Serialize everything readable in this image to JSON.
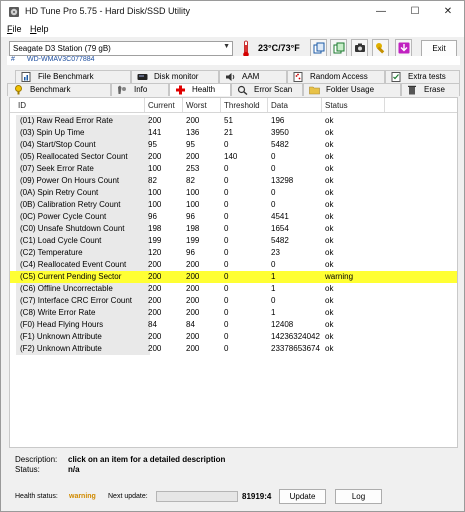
{
  "window": {
    "title": "HD Tune Pro 5.75 - Hard Disk/SSD Utility",
    "controls": [
      "—",
      "☐",
      "✕"
    ]
  },
  "menu": [
    {
      "label": "File",
      "key": "F",
      "rest": "ile"
    },
    {
      "label": "Help",
      "key": "H",
      "rest": "elp"
    }
  ],
  "toolbar": {
    "drive": "Seagate D3 Station (79 gB)",
    "temperature": "23°C/73°F",
    "exit_label": "Exit"
  },
  "serial": {
    "hash": "#",
    "id": "WD-WMAV3C077884"
  },
  "tabs_top": [
    {
      "label": "File Benchmark",
      "icon": "file-benchmark-icon"
    },
    {
      "label": "Disk monitor",
      "icon": "disk-monitor-icon"
    },
    {
      "label": "AAM",
      "icon": "speaker-icon"
    },
    {
      "label": "Random Access",
      "icon": "random-access-icon"
    },
    {
      "label": "Extra tests",
      "icon": "extra-tests-icon"
    }
  ],
  "tabs_bottom": [
    {
      "label": "Benchmark",
      "icon": "benchmark-icon"
    },
    {
      "label": "Info",
      "icon": "info-icon"
    },
    {
      "label": "Health",
      "icon": "health-cross-icon",
      "active": true
    },
    {
      "label": "Error Scan",
      "icon": "error-scan-icon"
    },
    {
      "label": "Folder Usage",
      "icon": "folder-icon"
    },
    {
      "label": "Erase",
      "icon": "erase-icon"
    }
  ],
  "table": {
    "headers": [
      "ID",
      "Current",
      "Worst",
      "Threshold",
      "Data",
      "Status"
    ],
    "rows": [
      [
        "(01) Raw Read Error Rate",
        "200",
        "200",
        "51",
        "196",
        "ok"
      ],
      [
        "(03) Spin Up Time",
        "141",
        "136",
        "21",
        "3950",
        "ok"
      ],
      [
        "(04) Start/Stop Count",
        "95",
        "95",
        "0",
        "5482",
        "ok"
      ],
      [
        "(05) Reallocated Sector Count",
        "200",
        "200",
        "140",
        "0",
        "ok"
      ],
      [
        "(07) Seek Error Rate",
        "100",
        "253",
        "0",
        "0",
        "ok"
      ],
      [
        "(09) Power On Hours Count",
        "82",
        "82",
        "0",
        "13298",
        "ok"
      ],
      [
        "(0A) Spin Retry Count",
        "100",
        "100",
        "0",
        "0",
        "ok"
      ],
      [
        "(0B) Calibration Retry Count",
        "100",
        "100",
        "0",
        "0",
        "ok"
      ],
      [
        "(0C) Power Cycle Count",
        "96",
        "96",
        "0",
        "4541",
        "ok"
      ],
      [
        "(C0) Unsafe Shutdown Count",
        "198",
        "198",
        "0",
        "1654",
        "ok"
      ],
      [
        "(C1) Load Cycle Count",
        "199",
        "199",
        "0",
        "5482",
        "ok"
      ],
      [
        "(C2) Temperature",
        "120",
        "96",
        "0",
        "23",
        "ok"
      ],
      [
        "(C4) Reallocated Event Count",
        "200",
        "200",
        "0",
        "0",
        "ok"
      ],
      [
        "(C5) Current Pending Sector",
        "200",
        "200",
        "0",
        "1",
        "warning"
      ],
      [
        "(C6) Offline Uncorrectable",
        "200",
        "200",
        "0",
        "1",
        "ok"
      ],
      [
        "(C7) Interface CRC Error Count",
        "200",
        "200",
        "0",
        "0",
        "ok"
      ],
      [
        "(C8) Write Error Rate",
        "200",
        "200",
        "0",
        "1",
        "ok"
      ],
      [
        "(F0) Head Flying Hours",
        "84",
        "84",
        "0",
        "12408",
        "ok"
      ],
      [
        "(F1) Unknown Attribute",
        "200",
        "200",
        "0",
        "14236324042",
        "ok"
      ],
      [
        "(F2) Unknown Attribute",
        "200",
        "200",
        "0",
        "23378653674",
        "ok"
      ]
    ],
    "highlight_row": 13,
    "highlight_color": "#ffff33"
  },
  "description": {
    "desc_label": "Description:",
    "desc_value": "click on an item for a detailed description",
    "status_label": "Status:",
    "status_value": "n/a"
  },
  "status_bar": {
    "health_label": "Health status:",
    "health_value": "warning",
    "next_update_label": "Next update:",
    "progress_fraction": 0.0,
    "counter": "81919:4",
    "update_label": "Update",
    "log_label": "Log"
  }
}
